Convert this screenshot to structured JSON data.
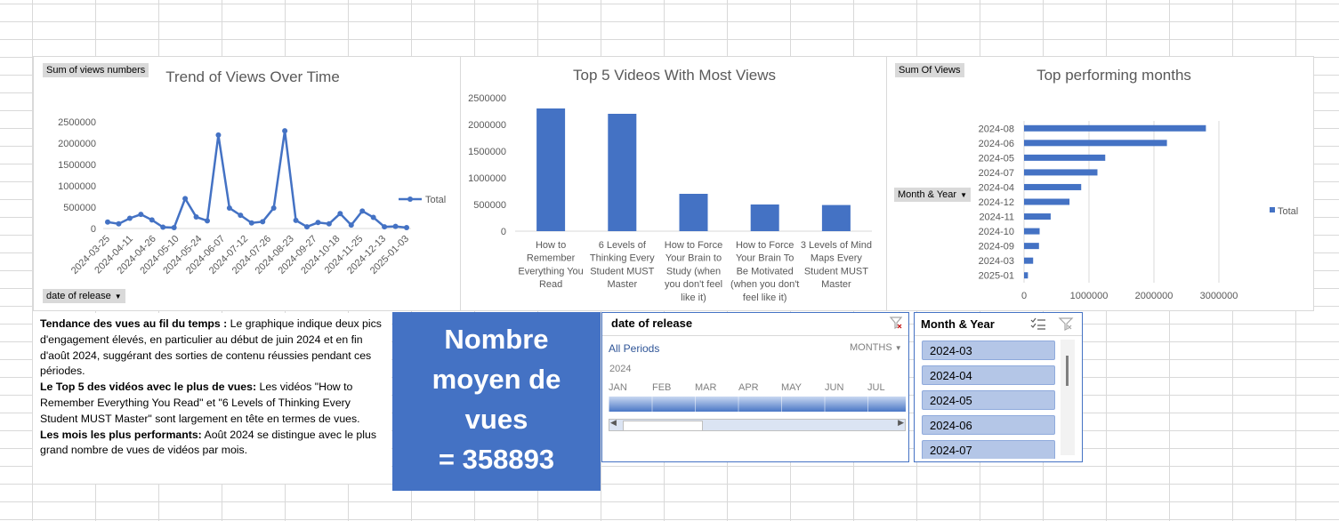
{
  "colors": {
    "accent": "#4472c4",
    "gridline": "#d9d9d9",
    "slicer_item": "#b4c6e7"
  },
  "trend_chart": {
    "field_button": "Sum of views numbers",
    "axis_button": "date of release",
    "legend": "Total"
  },
  "top5_chart": {},
  "months_chart": {
    "field_button": "Sum Of Views",
    "axis_button": "Month & Year",
    "legend": "Total"
  },
  "chart_data": [
    {
      "type": "line",
      "title": "Trend of Views Over Time",
      "xlabel": "",
      "ylabel": "",
      "ylim": [
        0,
        2500000
      ],
      "yticks": [
        0,
        500000,
        1000000,
        1500000,
        2000000,
        2500000
      ],
      "x_tick_labels": [
        "2024-03-25",
        "2024-04-11",
        "2024-04-26",
        "2024-05-10",
        "2024-05-24",
        "2024-06-07",
        "2024-07-12",
        "2024-07-26",
        "2024-08-23",
        "2024-09-27",
        "2024-10-18",
        "2024-11-25",
        "2024-12-13",
        "2025-01-03"
      ],
      "series": [
        {
          "name": "Total",
          "values": [
            150000,
            110000,
            240000,
            330000,
            200000,
            30000,
            20000,
            700000,
            270000,
            180000,
            2190000,
            480000,
            310000,
            130000,
            160000,
            480000,
            2290000,
            190000,
            40000,
            140000,
            110000,
            350000,
            80000,
            410000,
            260000,
            40000,
            50000,
            20000
          ]
        }
      ],
      "grid": false,
      "legend": "right"
    },
    {
      "type": "bar",
      "title": "Top 5 Videos With Most Views",
      "categories": [
        "How to Remember Everything You Read",
        "6 Levels of Thinking Every Student MUST Master",
        "How to Force Your Brain to Study (when you don't feel like it)",
        "How to Force Your Brain To Be Motivated (when you don't feel like it)",
        "3 Levels of Mind Maps Every Student MUST Master"
      ],
      "category_lines": [
        [
          "How to",
          "Remember",
          "Everything You",
          "Read"
        ],
        [
          "6 Levels of",
          "Thinking Every",
          "Student MUST",
          "Master"
        ],
        [
          "How to Force",
          "Your Brain to",
          "Study (when",
          "you don't feel",
          "like it)"
        ],
        [
          "How to Force",
          "Your Brain To",
          "Be Motivated",
          "(when you don't",
          "feel like it)"
        ],
        [
          "3 Levels of Mind",
          "Maps Every",
          "Student MUST",
          "Master"
        ]
      ],
      "values": [
        2300000,
        2200000,
        700000,
        500000,
        490000
      ],
      "ylim": [
        0,
        2500000
      ],
      "yticks": [
        0,
        500000,
        1000000,
        1500000,
        2000000,
        2500000
      ]
    },
    {
      "type": "bar",
      "orientation": "horizontal",
      "title": "Top performing months",
      "categories": [
        "2024-08",
        "2024-06",
        "2024-05",
        "2024-07",
        "2024-04",
        "2024-12",
        "2024-11",
        "2024-10",
        "2024-09",
        "2024-03",
        "2025-01"
      ],
      "values": [
        2800000,
        2200000,
        1250000,
        1130000,
        880000,
        700000,
        410000,
        240000,
        230000,
        140000,
        60000
      ],
      "xlim": [
        0,
        3000000
      ],
      "xticks": [
        0,
        1000000,
        2000000,
        3000000
      ],
      "series_name": "Total",
      "grid": true,
      "legend": "right"
    }
  ],
  "notes": [
    {
      "bold": "Tendance des vues au fil du temps :",
      "text": " Le graphique indique deux pics d'engagement élevés, en particulier au début de juin 2024 et en fin d'août 2024, suggérant des sorties de contenu réussies pendant ces périodes."
    },
    {
      "bold": "Le Top 5 des vidéos avec le plus de vues:",
      "text": " Les vidéos \"How to Remember Everything You Read\" et \"6 Levels of Thinking Every Student MUST Master\" sont largement en tête en termes de vues."
    },
    {
      "bold": "Les mois les plus performants:",
      "text": " Août 2024 se distingue avec le plus grand nombre de vues de vidéos par mois."
    }
  ],
  "avg_box": {
    "line1": "Nombre",
    "line2": "moyen de",
    "line3": "vues",
    "line4": "= 358893"
  },
  "timeline": {
    "title": "date of release",
    "all_periods": "All Periods",
    "unit": "MONTHS",
    "year": "2024",
    "months": [
      "JAN",
      "FEB",
      "MAR",
      "APR",
      "MAY",
      "JUN",
      "JUL"
    ]
  },
  "slicer": {
    "title": "Month & Year",
    "items": [
      "2024-03",
      "2024-04",
      "2024-05",
      "2024-06",
      "2024-07"
    ]
  }
}
